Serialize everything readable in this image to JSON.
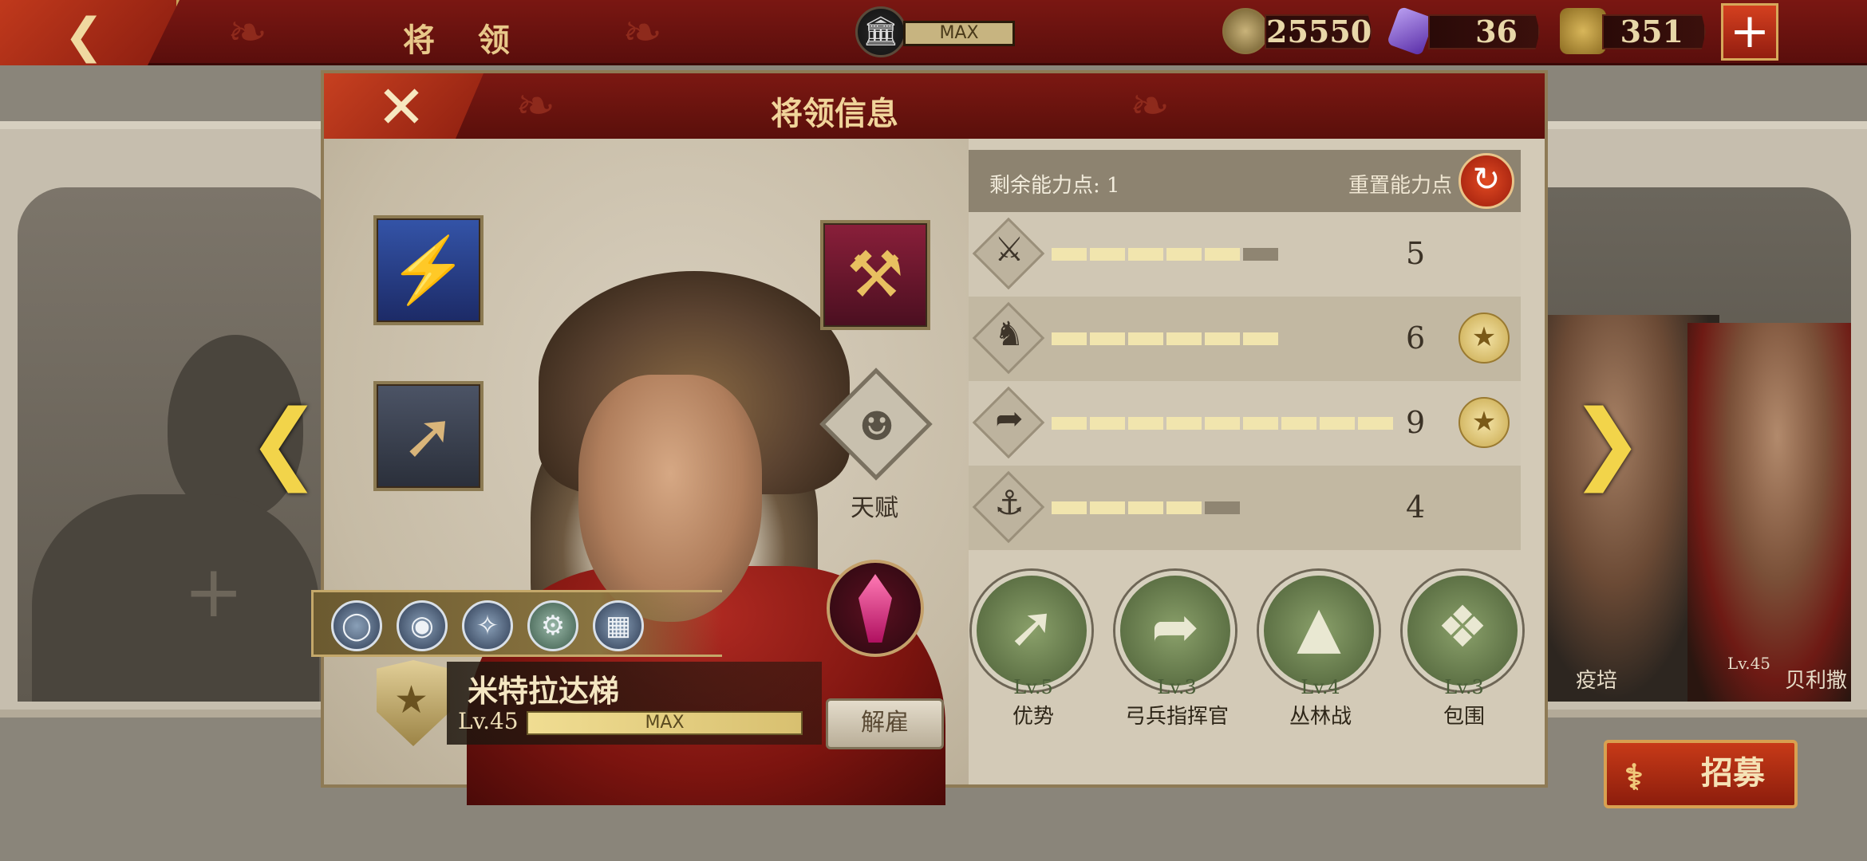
{
  "topbar": {
    "title": "将 领",
    "building_level": "MAX",
    "coins": "25550",
    "gems": "36",
    "honor": "351",
    "plus_label": "+"
  },
  "modal": {
    "title": "将领信息",
    "talent_label": "天赋",
    "general": {
      "name": "米特拉达梯",
      "level": "Lv.45",
      "xp_label": "MAX",
      "dismiss_label": "解雇"
    },
    "points": {
      "remaining_label": "剩余能力点: 1",
      "reset_label": "重置能力点"
    },
    "stats": [
      {
        "icon": "sword-icon",
        "value": "5",
        "filled": 5,
        "max": 6,
        "badge": false
      },
      {
        "icon": "horse-icon",
        "value": "6",
        "filled": 6,
        "max": 6,
        "badge": true
      },
      {
        "icon": "bow-icon",
        "value": "9",
        "filled": 9,
        "max": 9,
        "badge": true
      },
      {
        "icon": "anchor-icon",
        "value": "4",
        "filled": 4,
        "max": 5,
        "badge": false
      }
    ],
    "tactics": [
      {
        "level": "Lv.5",
        "name": "优势"
      },
      {
        "level": "Lv.3",
        "name": "弓兵指挥官"
      },
      {
        "level": "Lv.4",
        "name": "丛林战"
      },
      {
        "level": "Lv.3",
        "name": "包围"
      }
    ]
  },
  "background": {
    "right_names": [
      "疫培",
      "Lv.45",
      "贝利撒"
    ]
  },
  "recruit_label": "招募",
  "colors": {
    "accent_red": "#7a1712",
    "gold": "#f2d44a",
    "stat_fill": "#f1e5ae"
  }
}
